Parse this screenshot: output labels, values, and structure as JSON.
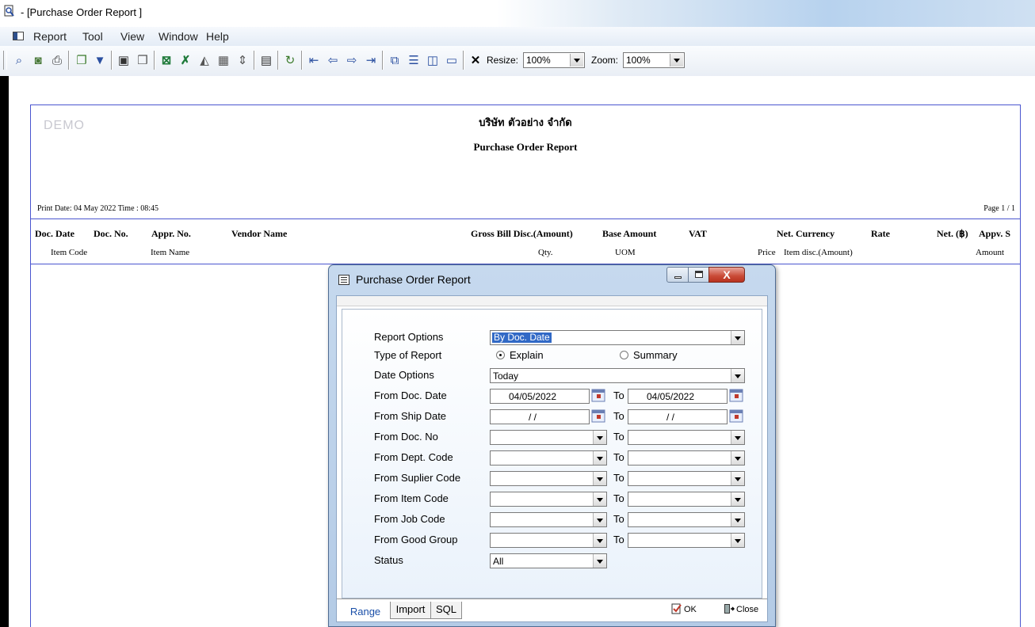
{
  "window": {
    "title": "- [Purchase Order Report ]"
  },
  "menu": [
    "Report",
    "Tool",
    "View",
    "Window",
    "Help"
  ],
  "toolbar": {
    "icons": [
      "zoom-page-icon",
      "zoom-icon",
      "print-icon",
      "copy-icon",
      "filter-icon",
      "save-icon",
      "open-icon",
      "excel-icon",
      "excel-export-icon",
      "chart-icon",
      "grid-icon",
      "fit-icon",
      "calculator-icon",
      "refresh-icon",
      "first-page-icon",
      "prev-page-icon",
      "next-page-icon",
      "last-page-icon",
      "tile-icon",
      "rows-icon",
      "columns-icon",
      "window-icon"
    ],
    "close_glyph": "✕",
    "resize_label": "Resize:",
    "resize_value": "100%",
    "zoom_label": "Zoom:",
    "zoom_value": "100%"
  },
  "report": {
    "watermark": "DEMO",
    "company": "บริษัท ตัวอย่าง จำกัด",
    "title": "Purchase Order Report",
    "print_date": "Print Date: 04 May 2022  Time : 08:45",
    "page": "Page 1 / 1",
    "header_row1": [
      "Doc. Date",
      "Doc. No.",
      "Appr. No.",
      "Vendor Name",
      "Gross Bill Disc.(Amount)",
      "Base Amount",
      "VAT",
      "Net. Currency",
      "Rate",
      "Net. (฿)",
      "Appv. S"
    ],
    "header_row2": [
      "Item Code",
      "Item Name",
      "Qty.",
      "UOM",
      "Price",
      "Item disc.(Amount)",
      "Amount"
    ]
  },
  "dialog": {
    "title": "Purchase Order Report",
    "close_glyph": "X",
    "fields": {
      "report_options": {
        "label": "Report Options",
        "value": "By Doc. Date"
      },
      "type_of_report": {
        "label": "Type of Report",
        "explain": "Explain",
        "summary": "Summary",
        "selected": "Explain"
      },
      "date_options": {
        "label": "Date Options",
        "value": "Today"
      },
      "doc_date": {
        "label": "From Doc. Date",
        "from": "04/05/2022",
        "to": "04/05/2022"
      },
      "ship_date": {
        "label": "From Ship Date",
        "from": "/ /",
        "to": "/ /"
      },
      "doc_no": {
        "label": "From Doc. No"
      },
      "dept_code": {
        "label": "From Dept. Code"
      },
      "supplier_code": {
        "label": "From Suplier Code"
      },
      "item_code": {
        "label": "From Item Code"
      },
      "job_code": {
        "label": "From Job Code"
      },
      "good_group": {
        "label": "From Good Group"
      },
      "status": {
        "label": "Status",
        "value": "All"
      }
    },
    "to_label": "To",
    "tabs": [
      "Range",
      "Import",
      "SQL"
    ],
    "ok_label": "OK",
    "close_label": "Close"
  }
}
